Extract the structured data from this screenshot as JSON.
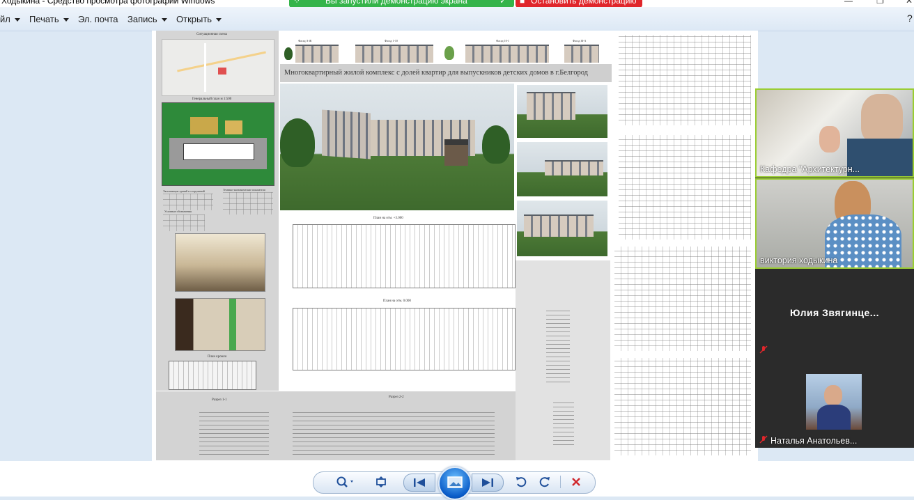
{
  "window": {
    "title": "Ходыкина - Средство просмотра фотографий Windows"
  },
  "share_banner": {
    "status_text": "Вы запустили демонстрацию экрана",
    "stop_button": "Остановить демонстрацию"
  },
  "menubar": {
    "items": [
      {
        "label": "йл",
        "has_dropdown": true
      },
      {
        "label": "Печать",
        "has_dropdown": true
      },
      {
        "label": "Эл. почта",
        "has_dropdown": false
      },
      {
        "label": "Запись",
        "has_dropdown": true
      },
      {
        "label": "Открыть",
        "has_dropdown": true
      }
    ]
  },
  "poster": {
    "title": "Многоквартирный жилой комплекс с долей квартир для выпускников детских домов в г.Белгород",
    "situation_scheme": "Ситуационная схема",
    "general_plan": "Генеральный план м 1:500",
    "explication": "Экспликация зданий и сооружений",
    "tech_indicators": "Технико-экономические показатели",
    "legend": "Условные обозначения",
    "roof_plan": "План кровли",
    "plan_upper": "План на отм. +3.000",
    "plan_ground": "План на отм. 0.000",
    "section_1": "Разрез 1-1",
    "section_2": "Разрез 2-2",
    "facades": [
      "Фасад А-Ж",
      "Фасад 1-10",
      "Фасад 10-1",
      "Фасад Ж-А"
    ]
  },
  "video_call": {
    "participants": [
      {
        "name": "Кафедра \"Архитектурн...",
        "video": true,
        "muted": false
      },
      {
        "name": "виктория ходыкина",
        "video": true,
        "muted": false
      },
      {
        "name": "Юлия  Звягинце...",
        "video": false,
        "muted": true
      },
      {
        "name": "Наталья Анатольев...",
        "video": true,
        "muted": true
      }
    ]
  },
  "viewer_toolbar": {
    "buttons": [
      "zoom-icon",
      "fit-window-icon",
      "previous-icon",
      "slideshow-icon",
      "next-icon",
      "rotate-ccw-icon",
      "rotate-cw-icon",
      "delete-icon"
    ]
  },
  "colors": {
    "share_green": "#35b44a",
    "stop_red": "#e0262b",
    "active_speaker_border": "#9acd32"
  }
}
